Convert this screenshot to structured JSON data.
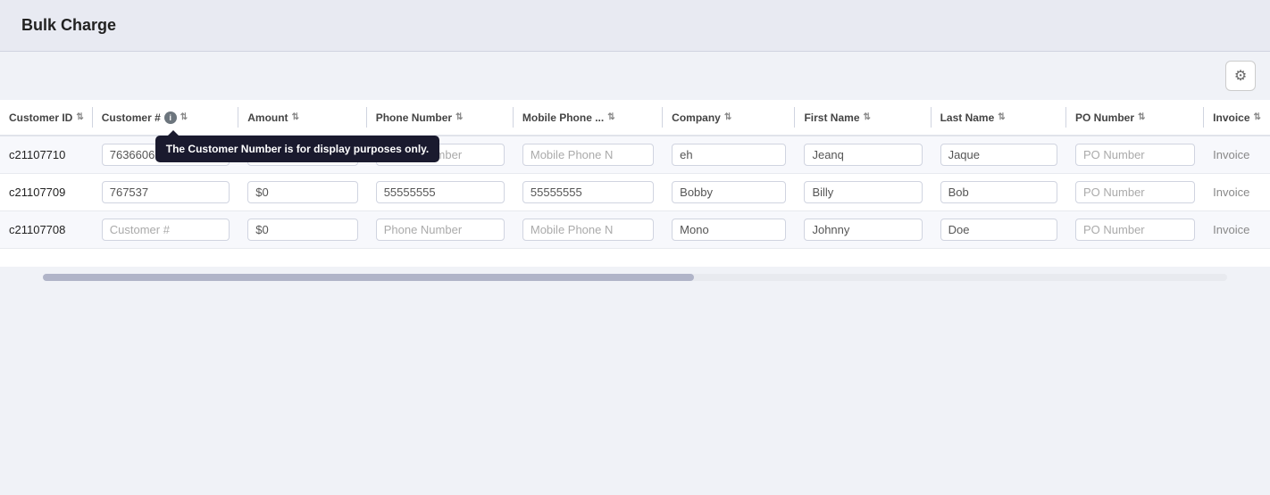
{
  "header": {
    "title": "Bulk Charge"
  },
  "toolbar": {
    "gear_label": "⚙"
  },
  "table": {
    "columns": [
      {
        "id": "customer_id",
        "label": "Customer ID",
        "sortable": true,
        "info": false
      },
      {
        "id": "customer_num",
        "label": "Customer #",
        "sortable": true,
        "info": true
      },
      {
        "id": "amount",
        "label": "Amount",
        "sortable": true,
        "info": false
      },
      {
        "id": "phone_number",
        "label": "Phone Number",
        "sortable": true,
        "info": false
      },
      {
        "id": "mobile_phone",
        "label": "Mobile Phone ...",
        "sortable": true,
        "info": false
      },
      {
        "id": "company",
        "label": "Company",
        "sortable": true,
        "info": false
      },
      {
        "id": "first_name",
        "label": "First Name",
        "sortable": true,
        "info": false
      },
      {
        "id": "last_name",
        "label": "Last Name",
        "sortable": true,
        "info": false
      },
      {
        "id": "po_number",
        "label": "PO Number",
        "sortable": true,
        "info": false
      },
      {
        "id": "invoice",
        "label": "Invoice",
        "sortable": true,
        "info": false
      }
    ],
    "tooltip": {
      "text": "The Customer Number is for display purposes only."
    },
    "rows": [
      {
        "customer_id": "c21107710",
        "customer_num": "7636606",
        "amount": "$0",
        "phone_number": "",
        "mobile_phone": "",
        "company": "eh",
        "first_name": "Jeanq",
        "last_name": "Jaque",
        "po_number": "",
        "invoice": "Invoice"
      },
      {
        "customer_id": "c21107709",
        "customer_num": "767537",
        "amount": "$0",
        "phone_number": "55555555",
        "mobile_phone": "55555555",
        "company": "Bobby",
        "first_name": "Billy",
        "last_name": "Bob",
        "po_number": "",
        "invoice": "Invoice"
      },
      {
        "customer_id": "c21107708",
        "customer_num": "",
        "amount": "$0",
        "phone_number": "",
        "mobile_phone": "",
        "company": "Mono",
        "first_name": "Johnny",
        "last_name": "Doe",
        "po_number": "",
        "invoice": "Invoice"
      }
    ],
    "placeholders": {
      "customer_num": "Customer #",
      "phone_number": "Phone Number",
      "mobile_phone": "Mobile Phone N",
      "po_number": "PO Number"
    }
  }
}
